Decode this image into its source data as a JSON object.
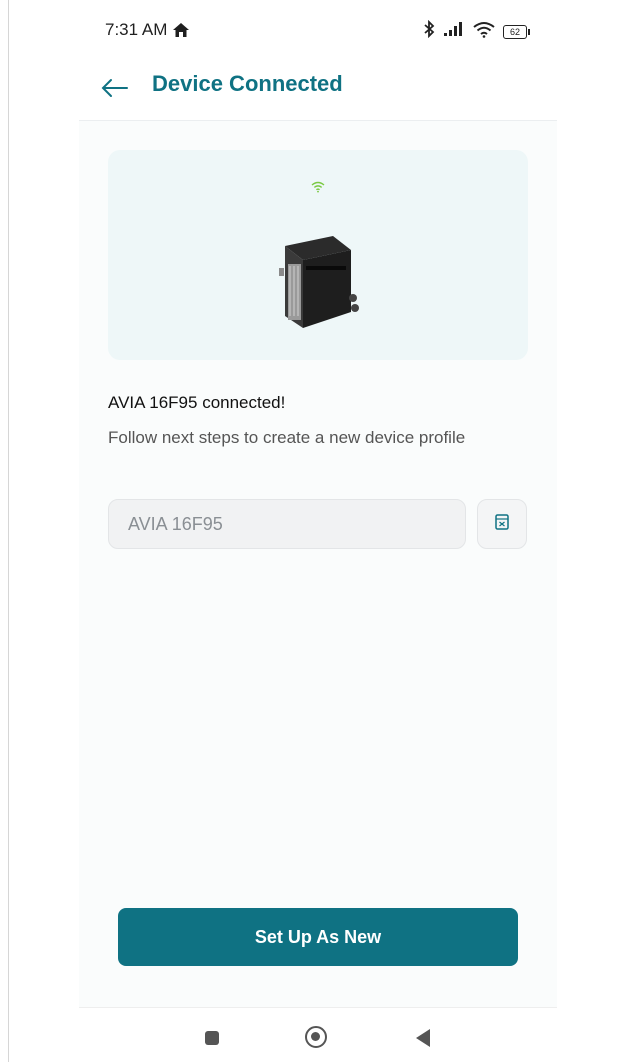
{
  "status_bar": {
    "time": "7:31 AM",
    "battery": "62",
    "icons": [
      "home-icon",
      "bluetooth-icon",
      "signal-icon",
      "wifi-icon",
      "battery-icon"
    ]
  },
  "header": {
    "title": "Device Connected",
    "back_icon": "arrow-left-icon"
  },
  "hero": {
    "wifi_icon": "wifi-icon",
    "image": "pool-heater-device"
  },
  "device": {
    "connected_text": "AVIA 16F95 connected!",
    "instruction_text": "Follow next steps to create a new device profile"
  },
  "name_field": {
    "value": "AVIA 16F95",
    "placeholder": "AVIA 16F95",
    "side_button_icon": "auto-name-icon"
  },
  "actions": {
    "primary_label": "Set Up As New"
  },
  "nav": {
    "items": [
      "recent-apps",
      "home",
      "back"
    ]
  },
  "colors": {
    "accent": "#0f7283",
    "hero_bg": "#eef7f8",
    "wifi": "#7ac943"
  }
}
